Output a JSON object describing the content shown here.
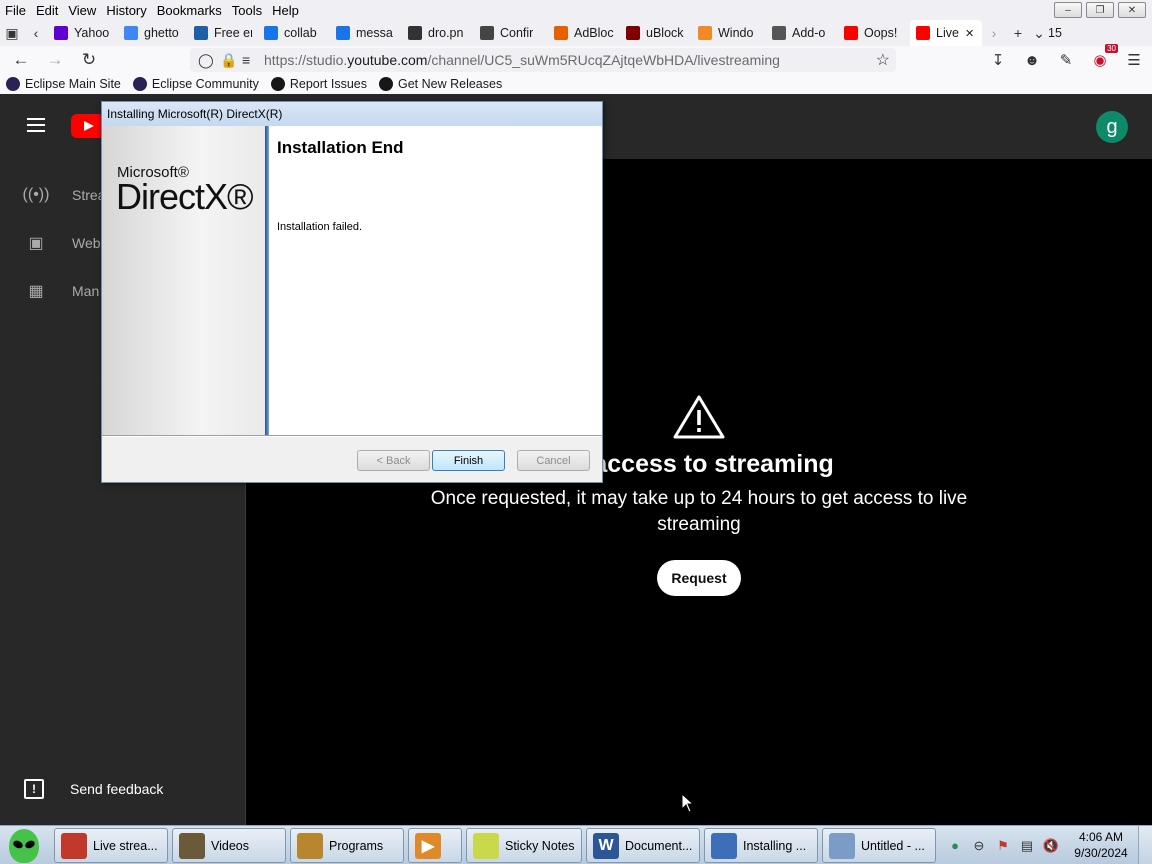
{
  "menubar": {
    "items": [
      "File",
      "Edit",
      "View",
      "History",
      "Bookmarks",
      "Tools",
      "Help"
    ]
  },
  "tabs": [
    {
      "label": "Yahoo",
      "icon": "yahoo-icon",
      "color": "#6001d2"
    },
    {
      "label": "ghetto",
      "icon": "google-icon",
      "color": "#4285f4"
    },
    {
      "label": "Free er",
      "icon": "m-icon",
      "color": "#1f5fa8"
    },
    {
      "label": "collab",
      "icon": "docs-icon",
      "color": "#1a73e8"
    },
    {
      "label": "messa",
      "icon": "docs-icon",
      "color": "#1a73e8"
    },
    {
      "label": "dro.pn",
      "icon": "image-icon",
      "color": "#333333"
    },
    {
      "label": "Confir",
      "icon": "eight-icon",
      "color": "#444444"
    },
    {
      "label": "AdBloc",
      "icon": "firefox-icon",
      "color": "#e66000"
    },
    {
      "label": "uBlock",
      "icon": "ublock-icon",
      "color": "#800000"
    },
    {
      "label": "Windo",
      "icon": "diamond-icon",
      "color": "#f08a24"
    },
    {
      "label": "Add-o",
      "icon": "puzzle-icon",
      "color": "#555555"
    },
    {
      "label": "Oops!",
      "icon": "youtube-icon",
      "color": "#ff0000"
    },
    {
      "label": "Live",
      "icon": "youtube-icon",
      "color": "#ff0000"
    }
  ],
  "tab_count": "15",
  "urlbar": {
    "url_prefix": "https://studio.",
    "url_domain": "youtube.com",
    "url_path": "/channel/UC5_suWm5RUcqZAjtqeWbHDA/livestreaming"
  },
  "ublock_badge": "30",
  "bookmarks": [
    {
      "label": "Eclipse Main Site",
      "color": "#2c2255"
    },
    {
      "label": "Eclipse Community",
      "color": "#2c2255"
    },
    {
      "label": "Report Issues",
      "color": "#181717"
    },
    {
      "label": "Get New Releases",
      "color": "#181717"
    }
  ],
  "yt": {
    "avatar_letter": "g",
    "sidebar": [
      {
        "label": "Strea",
        "icon": "live-icon"
      },
      {
        "label": "Web",
        "icon": "camera-icon"
      },
      {
        "label": "Man",
        "icon": "calendar-icon"
      }
    ],
    "feedback_label": "Send feedback",
    "title": "st access to streaming",
    "body": "Once requested, it may take up to 24 hours to get access to live streaming",
    "request_label": "Request"
  },
  "dialog": {
    "title": "Installing Microsoft(R) DirectX(R)",
    "brand_small": "Microsoft®",
    "brand_big": "DirectX®",
    "heading": "Installation End",
    "message": "Installation failed.",
    "back_label": "< Back",
    "finish_label": "Finish",
    "cancel_label": "Cancel"
  },
  "taskbar": {
    "tasks": [
      {
        "label": "Live strea...",
        "color": "#c0392b"
      },
      {
        "label": "Videos",
        "color": "#6b5a3a"
      },
      {
        "label": "Programs",
        "color": "#b8862e"
      },
      {
        "label": "",
        "color": "#e0892a"
      },
      {
        "label": "Sticky Notes",
        "color": "#c9d94a"
      },
      {
        "label": "Document...",
        "color": "#2b5797"
      },
      {
        "label": "Installing ...",
        "color": "#3d6fb8"
      },
      {
        "label": "Untitled - ...",
        "color": "#7a9cc6"
      }
    ],
    "time": "4:06 AM",
    "date": "9/30/2024"
  }
}
